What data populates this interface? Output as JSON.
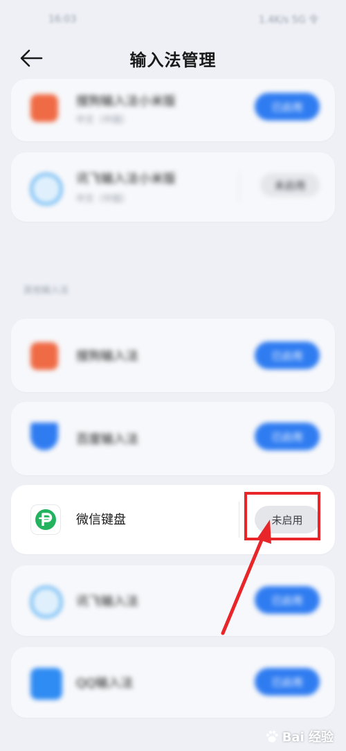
{
  "status_bar": {
    "time": "16:03",
    "indicators": "1.4K/s 5G 令"
  },
  "header": {
    "title": "输入法管理",
    "back_icon": "arrow-left-icon"
  },
  "top_cards": [
    {
      "name": "搜狗输入法小米版",
      "sub": "中文（中国）",
      "button": "已启用",
      "enabled": true,
      "icon": "sogou-icon",
      "color": "#ef6b45"
    },
    {
      "name": "讯飞输入法小米版",
      "sub": "中文（中国）",
      "button": "未启用",
      "enabled": false,
      "icon": "iflytek-icon",
      "color": "#3aa0f0"
    }
  ],
  "section_label": "其他输入法",
  "apps": [
    {
      "name": "搜狗输入法",
      "button": "已启用",
      "enabled": true,
      "icon": "sogou-icon",
      "color": "#ef6b45"
    },
    {
      "name": "百度输入法",
      "button": "已启用",
      "enabled": true,
      "icon": "baidu-icon",
      "color": "#2f7cf1"
    },
    {
      "name": "微信键盘",
      "button": "未启用",
      "enabled": false,
      "icon": "wechat-keyboard-icon",
      "color": "#23b35e"
    },
    {
      "name": "讯飞输入法",
      "button": "已启用",
      "enabled": true,
      "icon": "iflytek-icon",
      "color": "#3aa0f0"
    },
    {
      "name": "QQ输入法",
      "button": "已启用",
      "enabled": true,
      "icon": "qq-input-icon",
      "color": "#2f8cf3"
    }
  ],
  "accent_color": "#2f7cf1",
  "annotation_color": "#e8262a",
  "watermark": "Bai 经验"
}
